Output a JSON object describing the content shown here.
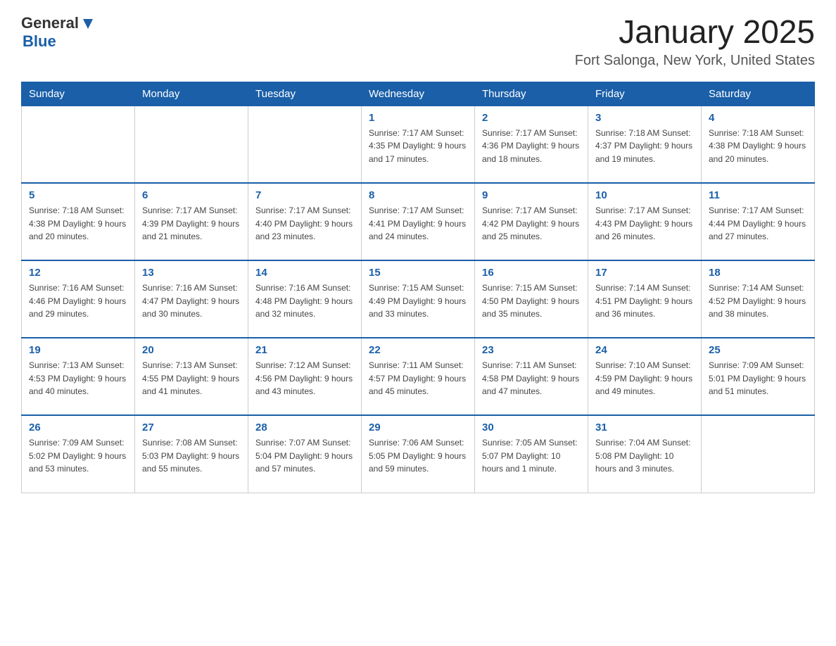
{
  "header": {
    "logo_general": "General",
    "logo_blue": "Blue",
    "title": "January 2025",
    "subtitle": "Fort Salonga, New York, United States"
  },
  "days_of_week": [
    "Sunday",
    "Monday",
    "Tuesday",
    "Wednesday",
    "Thursday",
    "Friday",
    "Saturday"
  ],
  "weeks": [
    [
      {
        "day": "",
        "info": ""
      },
      {
        "day": "",
        "info": ""
      },
      {
        "day": "",
        "info": ""
      },
      {
        "day": "1",
        "info": "Sunrise: 7:17 AM\nSunset: 4:35 PM\nDaylight: 9 hours\nand 17 minutes."
      },
      {
        "day": "2",
        "info": "Sunrise: 7:17 AM\nSunset: 4:36 PM\nDaylight: 9 hours\nand 18 minutes."
      },
      {
        "day": "3",
        "info": "Sunrise: 7:18 AM\nSunset: 4:37 PM\nDaylight: 9 hours\nand 19 minutes."
      },
      {
        "day": "4",
        "info": "Sunrise: 7:18 AM\nSunset: 4:38 PM\nDaylight: 9 hours\nand 20 minutes."
      }
    ],
    [
      {
        "day": "5",
        "info": "Sunrise: 7:18 AM\nSunset: 4:38 PM\nDaylight: 9 hours\nand 20 minutes."
      },
      {
        "day": "6",
        "info": "Sunrise: 7:17 AM\nSunset: 4:39 PM\nDaylight: 9 hours\nand 21 minutes."
      },
      {
        "day": "7",
        "info": "Sunrise: 7:17 AM\nSunset: 4:40 PM\nDaylight: 9 hours\nand 23 minutes."
      },
      {
        "day": "8",
        "info": "Sunrise: 7:17 AM\nSunset: 4:41 PM\nDaylight: 9 hours\nand 24 minutes."
      },
      {
        "day": "9",
        "info": "Sunrise: 7:17 AM\nSunset: 4:42 PM\nDaylight: 9 hours\nand 25 minutes."
      },
      {
        "day": "10",
        "info": "Sunrise: 7:17 AM\nSunset: 4:43 PM\nDaylight: 9 hours\nand 26 minutes."
      },
      {
        "day": "11",
        "info": "Sunrise: 7:17 AM\nSunset: 4:44 PM\nDaylight: 9 hours\nand 27 minutes."
      }
    ],
    [
      {
        "day": "12",
        "info": "Sunrise: 7:16 AM\nSunset: 4:46 PM\nDaylight: 9 hours\nand 29 minutes."
      },
      {
        "day": "13",
        "info": "Sunrise: 7:16 AM\nSunset: 4:47 PM\nDaylight: 9 hours\nand 30 minutes."
      },
      {
        "day": "14",
        "info": "Sunrise: 7:16 AM\nSunset: 4:48 PM\nDaylight: 9 hours\nand 32 minutes."
      },
      {
        "day": "15",
        "info": "Sunrise: 7:15 AM\nSunset: 4:49 PM\nDaylight: 9 hours\nand 33 minutes."
      },
      {
        "day": "16",
        "info": "Sunrise: 7:15 AM\nSunset: 4:50 PM\nDaylight: 9 hours\nand 35 minutes."
      },
      {
        "day": "17",
        "info": "Sunrise: 7:14 AM\nSunset: 4:51 PM\nDaylight: 9 hours\nand 36 minutes."
      },
      {
        "day": "18",
        "info": "Sunrise: 7:14 AM\nSunset: 4:52 PM\nDaylight: 9 hours\nand 38 minutes."
      }
    ],
    [
      {
        "day": "19",
        "info": "Sunrise: 7:13 AM\nSunset: 4:53 PM\nDaylight: 9 hours\nand 40 minutes."
      },
      {
        "day": "20",
        "info": "Sunrise: 7:13 AM\nSunset: 4:55 PM\nDaylight: 9 hours\nand 41 minutes."
      },
      {
        "day": "21",
        "info": "Sunrise: 7:12 AM\nSunset: 4:56 PM\nDaylight: 9 hours\nand 43 minutes."
      },
      {
        "day": "22",
        "info": "Sunrise: 7:11 AM\nSunset: 4:57 PM\nDaylight: 9 hours\nand 45 minutes."
      },
      {
        "day": "23",
        "info": "Sunrise: 7:11 AM\nSunset: 4:58 PM\nDaylight: 9 hours\nand 47 minutes."
      },
      {
        "day": "24",
        "info": "Sunrise: 7:10 AM\nSunset: 4:59 PM\nDaylight: 9 hours\nand 49 minutes."
      },
      {
        "day": "25",
        "info": "Sunrise: 7:09 AM\nSunset: 5:01 PM\nDaylight: 9 hours\nand 51 minutes."
      }
    ],
    [
      {
        "day": "26",
        "info": "Sunrise: 7:09 AM\nSunset: 5:02 PM\nDaylight: 9 hours\nand 53 minutes."
      },
      {
        "day": "27",
        "info": "Sunrise: 7:08 AM\nSunset: 5:03 PM\nDaylight: 9 hours\nand 55 minutes."
      },
      {
        "day": "28",
        "info": "Sunrise: 7:07 AM\nSunset: 5:04 PM\nDaylight: 9 hours\nand 57 minutes."
      },
      {
        "day": "29",
        "info": "Sunrise: 7:06 AM\nSunset: 5:05 PM\nDaylight: 9 hours\nand 59 minutes."
      },
      {
        "day": "30",
        "info": "Sunrise: 7:05 AM\nSunset: 5:07 PM\nDaylight: 10 hours\nand 1 minute."
      },
      {
        "day": "31",
        "info": "Sunrise: 7:04 AM\nSunset: 5:08 PM\nDaylight: 10 hours\nand 3 minutes."
      },
      {
        "day": "",
        "info": ""
      }
    ]
  ]
}
